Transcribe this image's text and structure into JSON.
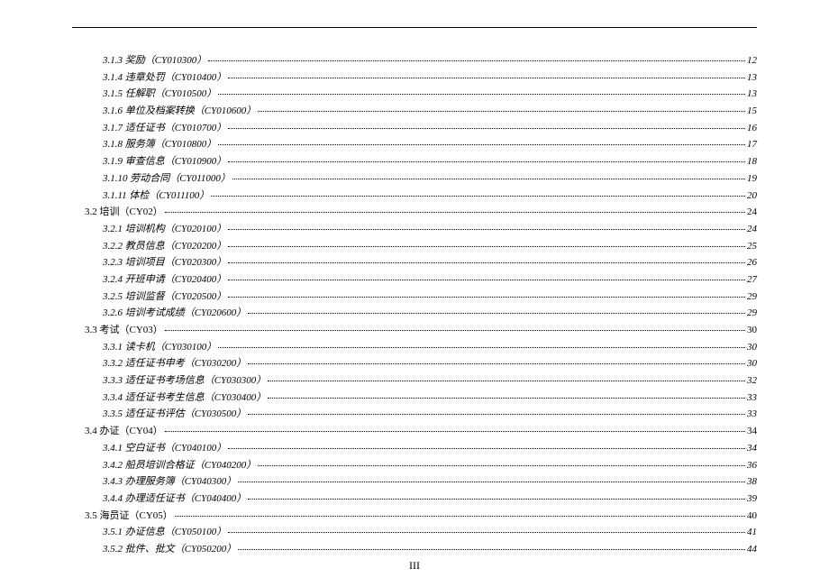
{
  "footer_page": "III",
  "entries": [
    {
      "level": 3,
      "label": "3.1.3 奖励（CY010300）",
      "page": "12"
    },
    {
      "level": 3,
      "label": "3.1.4 违章处罚（CY010400）",
      "page": "13"
    },
    {
      "level": 3,
      "label": "3.1.5 任解职（CY010500）",
      "page": "13"
    },
    {
      "level": 3,
      "label": "3.1.6 单位及档案转换（CY010600）",
      "page": "15"
    },
    {
      "level": 3,
      "label": "3.1.7 适任证书（CY010700）",
      "page": "16"
    },
    {
      "level": 3,
      "label": "3.1.8 服务簿（CY010800）",
      "page": "17"
    },
    {
      "level": 3,
      "label": "3.1.9 审查信息（CY010900）",
      "page": "18"
    },
    {
      "level": 3,
      "label": "3.1.10 劳动合同（CY011000）",
      "page": "19"
    },
    {
      "level": 3,
      "label": "3.1.11 体检（CY011100）",
      "page": "20"
    },
    {
      "level": 2,
      "label": "3.2 培训（CY02）",
      "page": "24"
    },
    {
      "level": 3,
      "label": "3.2.1 培训机构（CY020100）",
      "page": "24"
    },
    {
      "level": 3,
      "label": "3.2.2 教员信息（CY020200）",
      "page": "25"
    },
    {
      "level": 3,
      "label": "3.2.3 培训项目（CY020300）",
      "page": "26"
    },
    {
      "level": 3,
      "label": "3.2.4 开班申请（CY020400）",
      "page": "27"
    },
    {
      "level": 3,
      "label": "3.2.5 培训监督（CY020500）",
      "page": "29"
    },
    {
      "level": 3,
      "label": "3.2.6 培训考试成绩（CY020600）",
      "page": "29"
    },
    {
      "level": 2,
      "label": "3.3 考试（CY03）",
      "page": "30"
    },
    {
      "level": 3,
      "label": "3.3.1 读卡机（CY030100）",
      "page": "30"
    },
    {
      "level": 3,
      "label": "3.3.2 适任证书申考（CY030200）",
      "page": "30"
    },
    {
      "level": 3,
      "label": "3.3.3 适任证书考场信息（CY030300）",
      "page": "32"
    },
    {
      "level": 3,
      "label": "3.3.4 适任证书考生信息（CY030400）",
      "page": "33"
    },
    {
      "level": 3,
      "label": "3.3.5 适任证书评估（CY030500）",
      "page": "33"
    },
    {
      "level": 2,
      "label": "3.4 办证（CY04）",
      "page": "34"
    },
    {
      "level": 3,
      "label": "3.4.1 空白证书（CY040100）",
      "page": "34"
    },
    {
      "level": 3,
      "label": "3.4.2 船员培训合格证（CY040200）",
      "page": "36"
    },
    {
      "level": 3,
      "label": "3.4.3 办理服务簿（CY040300）",
      "page": "38"
    },
    {
      "level": 3,
      "label": "3.4.4 办理适任证书（CY040400）",
      "page": "39"
    },
    {
      "level": 2,
      "label": "3.5 海员证（CY05）",
      "page": "40"
    },
    {
      "level": 3,
      "label": "3.5.1 办证信息（CY050100）",
      "page": "41"
    },
    {
      "level": 3,
      "label": "3.5.2 批件、批文（CY050200）",
      "page": "44"
    }
  ]
}
